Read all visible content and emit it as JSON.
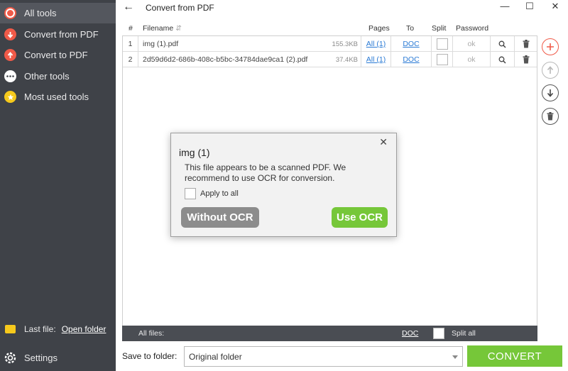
{
  "sidebar": {
    "items": [
      {
        "label": "All tools",
        "icon": "target-icon"
      },
      {
        "label": "Convert from PDF",
        "icon": "arrow-down-circle-icon"
      },
      {
        "label": "Convert to PDF",
        "icon": "arrow-up-circle-icon"
      },
      {
        "label": "Other tools",
        "icon": "more-dots-icon"
      },
      {
        "label": "Most used tools",
        "icon": "star-icon"
      }
    ],
    "last_file_label": "Last file:",
    "open_folder_label": "Open folder",
    "settings_label": "Settings"
  },
  "window": {
    "title": "Convert from PDF",
    "minimize": "—",
    "maximize": "☐",
    "close": "✕"
  },
  "table": {
    "headers": {
      "num": "#",
      "filename": "Filename",
      "pages": "Pages",
      "to": "To",
      "split": "Split",
      "password": "Password"
    },
    "rows": [
      {
        "num": "1",
        "filename": "img (1).pdf",
        "size": "155.3KB",
        "pages": "All (1)",
        "to": "DOC",
        "password": "ok"
      },
      {
        "num": "2",
        "filename": "2d59d6d2-686b-408c-b5bc-34784dae9ca1 (2).pdf",
        "size": "37.4KB",
        "pages": "All (1)",
        "to": "DOC",
        "password": "ok"
      }
    ],
    "all_files_label": "All files:",
    "all_files_to": "DOC",
    "split_all_label": "Split all"
  },
  "save": {
    "label": "Save to folder:",
    "value": "Original folder"
  },
  "convert_label": "CONVERT",
  "dialog": {
    "title": "img (1)",
    "message": "This file appears to be a scanned PDF. We recommend to use OCR for conversion.",
    "apply_all_label": "Apply to all",
    "without_ocr_label": "Without OCR",
    "use_ocr_label": "Use OCR"
  },
  "colors": {
    "sidebar_bg": "#3f4248",
    "accent_red": "#f05a48",
    "accent_green": "#76c739",
    "link_blue": "#2a7ad5"
  }
}
